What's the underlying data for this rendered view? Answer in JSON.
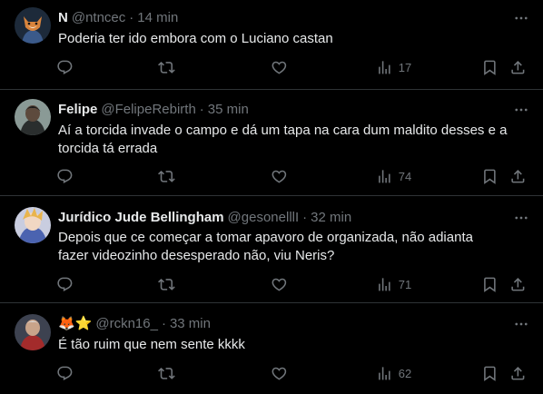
{
  "tweets": [
    {
      "name": "N",
      "name_emoji": "",
      "handle": "@ntncec",
      "separator": "·",
      "time": "14 min",
      "text": "Poderia ter ido embora com o Luciano castan",
      "views": "17",
      "avatar_colors": [
        "#3b5a8a",
        "#d9843c"
      ]
    },
    {
      "name": "Felipe",
      "name_emoji": "",
      "handle": "@FelipeRebirth",
      "separator": "·",
      "time": "35 min",
      "text": "Aí a torcida invade o campo e dá um tapa na cara dum maldito desses e a torcida tá errada",
      "views": "74",
      "avatar_colors": [
        "#5d6b6a",
        "#2a2e2e"
      ]
    },
    {
      "name": "Jurídico Jude Bellingham",
      "name_emoji": "",
      "handle": "@gesonelllI",
      "separator": "·",
      "time": "32 min",
      "text": "Depois que ce começar a tomar apavoro de organizada, não adianta fazer videozinho desesperado não, viu Neris?",
      "views": "71",
      "avatar_colors": [
        "#c9cde0",
        "#e9b44c"
      ]
    },
    {
      "name": "",
      "name_emoji": "🦊⭐",
      "handle": "@rckn16_",
      "separator": "·",
      "time": "33 min",
      "text": "É tão ruim que nem sente kkkk",
      "views": "62",
      "avatar_colors": [
        "#6b7285",
        "#a32b2b"
      ]
    }
  ],
  "icons": {
    "more": "more-horizontal-icon",
    "reply": "reply-icon",
    "retweet": "retweet-icon",
    "like": "heart-icon",
    "views": "analytics-icon",
    "bookmark": "bookmark-icon",
    "share": "share-icon"
  },
  "colors": {
    "background": "#000000",
    "text": "#e7e9ea",
    "secondary": "#71767b",
    "divider": "#2f3336"
  }
}
